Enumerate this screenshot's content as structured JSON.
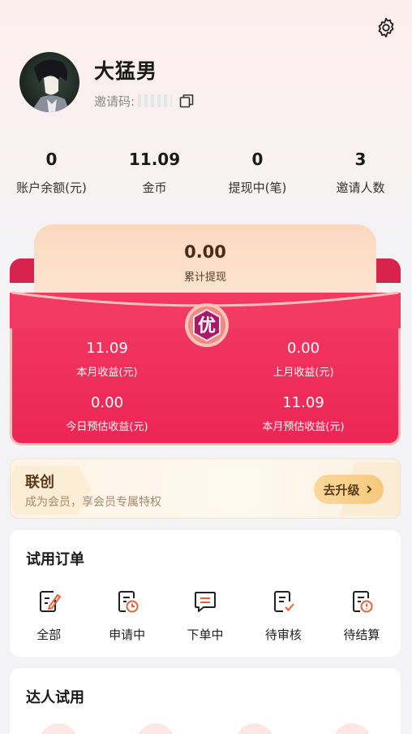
{
  "profile": {
    "username": "大猛男",
    "invite_label": "邀请码:"
  },
  "stats": [
    {
      "value": "0",
      "label": "账户余额(元)"
    },
    {
      "value": "11.09",
      "label": "金币"
    },
    {
      "value": "0",
      "label": "提现中(笔)"
    },
    {
      "value": "3",
      "label": "邀请人数"
    }
  ],
  "envelope": {
    "withdraw_value": "0.00",
    "withdraw_label": "累计提现",
    "badge_char": "优",
    "earnings": [
      {
        "value": "11.09",
        "label": "本月收益(元)"
      },
      {
        "value": "0.00",
        "label": "上月收益(元)"
      },
      {
        "value": "0.00",
        "label": "今日预估收益(元)"
      },
      {
        "value": "11.09",
        "label": "本月预估收益(元)"
      }
    ]
  },
  "member": {
    "title": "联创",
    "subtitle": "成为会员，享会员专属特权",
    "button": "去升级"
  },
  "trial_orders": {
    "title": "试用订单",
    "items": [
      {
        "label": "全部",
        "icon": "edit-doc-icon"
      },
      {
        "label": "申请中",
        "icon": "clock-doc-icon"
      },
      {
        "label": "下单中",
        "icon": "chat-icon"
      },
      {
        "label": "待审核",
        "icon": "check-doc-icon"
      },
      {
        "label": "待结算",
        "icon": "alert-doc-icon"
      }
    ]
  },
  "expert_trial": {
    "title": "达人试用"
  },
  "colors": {
    "accent_red": "#ec2655",
    "brand_orange": "#e8613a",
    "gold": "#f6c97c"
  }
}
